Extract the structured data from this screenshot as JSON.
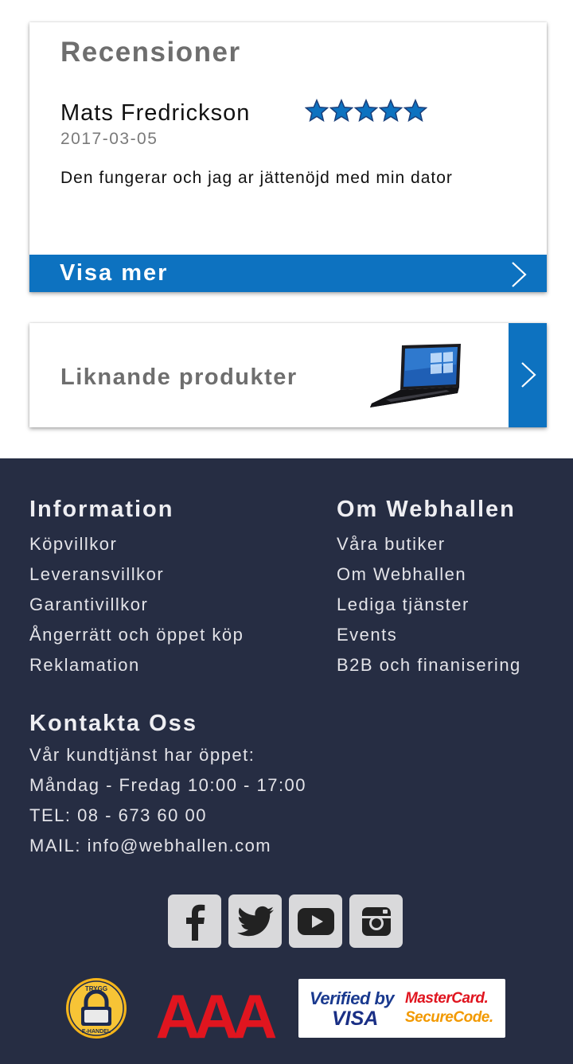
{
  "reviews": {
    "title": "Recensioner",
    "reviewer": "Mats Fredrickson",
    "rating": 5,
    "rating_max": 5,
    "date": "2017-03-05",
    "text": "Den fungerar och jag ar jättenöjd med min dator",
    "show_more_label": "Visa mer"
  },
  "similar": {
    "label": "Liknande produkter"
  },
  "footer": {
    "information": {
      "heading": "Information",
      "links": [
        "Köpvillkor",
        "Leveransvillkor",
        "Garantivillkor",
        "Ångerrätt och öppet köp",
        "Reklamation"
      ]
    },
    "om": {
      "heading": "Om Webhallen",
      "links": [
        "Våra butiker",
        "Om Webhallen",
        "Lediga tjänster",
        "Events",
        "B2B och finanisering"
      ]
    },
    "contact": {
      "heading": "Kontakta Oss",
      "hours_label": "Vår kundtjänst har öppet:",
      "hours": "Måndag - Fredag 10:00 - 17:00",
      "phone": "TEL: 08 - 673 60 00",
      "mail": "MAIL: info@webhallen.com"
    },
    "social": [
      "facebook-icon",
      "twitter-icon",
      "youtube-icon",
      "instagram-icon"
    ],
    "badges": {
      "trygg_text_top": "TRYGG",
      "trygg_text_bottom": "E-HANDEL",
      "aaa_text": "AAA",
      "verified_by": "Verified by",
      "visa": "VISA",
      "mastercard": "MasterCard.",
      "securecode": "SecureCode."
    }
  },
  "colors": {
    "accent": "#0d72c0",
    "star": "#0d72c0",
    "footer_bg": "#262d43",
    "aaa_red": "#e0151f"
  }
}
